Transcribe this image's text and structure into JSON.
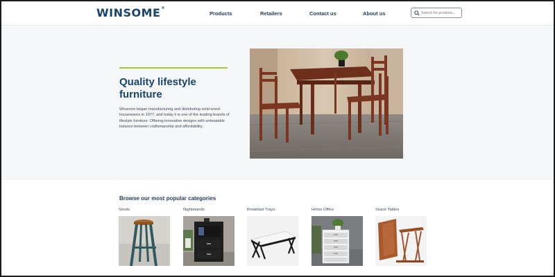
{
  "header": {
    "logo": "WINSOME",
    "logo_mark": "®",
    "nav": [
      "Products",
      "Retailers",
      "Contact us",
      "About us"
    ],
    "search_placeholder": "Search for products..."
  },
  "hero": {
    "title": "Quality lifestyle furniture",
    "text": "Winsome began manufacturing and distributing solid wood housewares in 1977, and today it is one of the leading brands of lifestyle furniture. Offering innovative designs with unbeatable balance between craftsmanship and affordability."
  },
  "categories": {
    "heading": "Browse our most popular categories",
    "items": [
      {
        "label": "Stools"
      },
      {
        "label": "Nightstands"
      },
      {
        "label": "Breakfast Trays"
      },
      {
        "label": "Home Office"
      },
      {
        "label": "Snack Tables"
      }
    ]
  },
  "colors": {
    "brand": "#17456f",
    "accent": "#a4c639",
    "hero_bg": "#f4f6f8"
  }
}
